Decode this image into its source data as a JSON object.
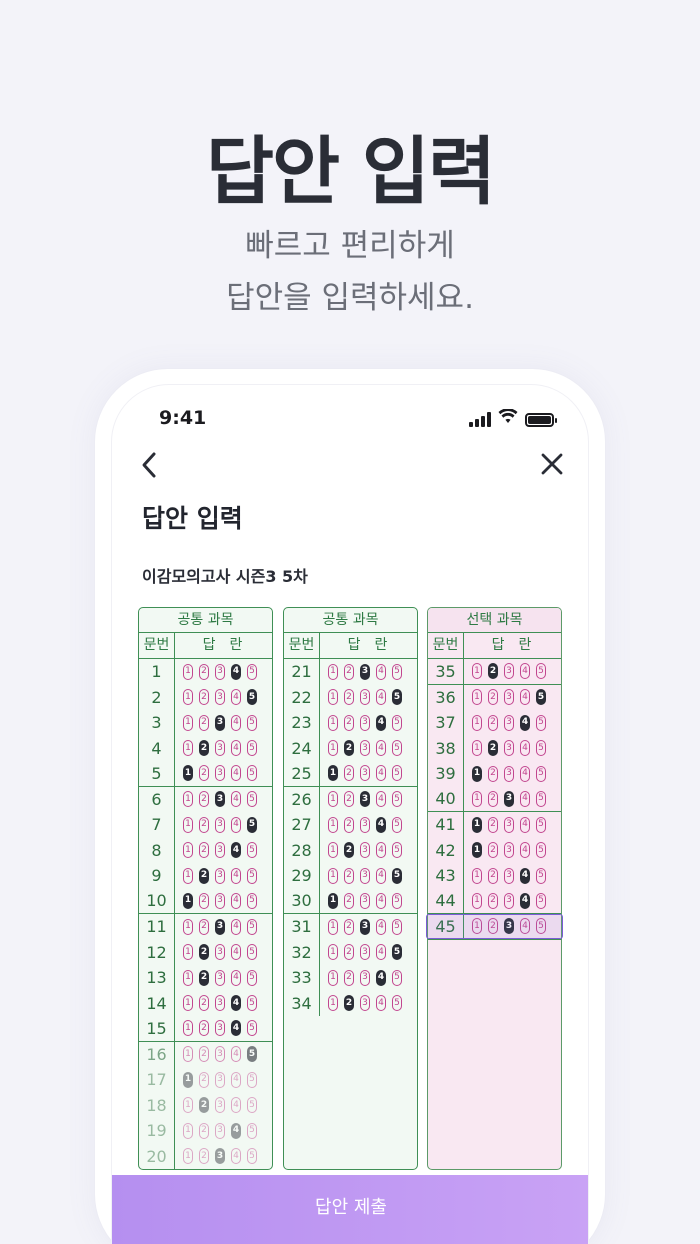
{
  "hero": {
    "title": "답안 입력",
    "sub1": "빠르고 편리하게",
    "sub2": "답안을 입력하세요."
  },
  "status": {
    "time": "9:41"
  },
  "header": {
    "back_icon": "chevron-left-icon",
    "close_icon": "close-icon",
    "title": "답안 입력",
    "exam_name": "이감모의고사 시즌3 5차"
  },
  "columns": [
    {
      "section": "공통 과목",
      "num_label": "문번",
      "ans_label": "답란",
      "theme": "green",
      "rows": [
        {
          "n": "1",
          "sel": 4
        },
        {
          "n": "2",
          "sel": 5
        },
        {
          "n": "3",
          "sel": 3
        },
        {
          "n": "4",
          "sel": 2
        },
        {
          "n": "5",
          "sel": 1
        },
        {
          "n": "6",
          "sel": 3
        },
        {
          "n": "7",
          "sel": 5
        },
        {
          "n": "8",
          "sel": 4
        },
        {
          "n": "9",
          "sel": 2
        },
        {
          "n": "10",
          "sel": 1
        },
        {
          "n": "11",
          "sel": 3
        },
        {
          "n": "12",
          "sel": 2
        },
        {
          "n": "13",
          "sel": 2
        },
        {
          "n": "14",
          "sel": 4
        },
        {
          "n": "15",
          "sel": 4
        },
        {
          "n": "16",
          "sel": 5
        },
        {
          "n": "17",
          "sel": 1
        },
        {
          "n": "18",
          "sel": 2
        },
        {
          "n": "19",
          "sel": 4
        },
        {
          "n": "20",
          "sel": 3
        }
      ]
    },
    {
      "section": "공통 과목",
      "num_label": "문번",
      "ans_label": "답란",
      "theme": "green",
      "rows": [
        {
          "n": "21",
          "sel": 3
        },
        {
          "n": "22",
          "sel": 5
        },
        {
          "n": "23",
          "sel": 4
        },
        {
          "n": "24",
          "sel": 2
        },
        {
          "n": "25",
          "sel": 1
        },
        {
          "n": "26",
          "sel": 3
        },
        {
          "n": "27",
          "sel": 4
        },
        {
          "n": "28",
          "sel": 2
        },
        {
          "n": "29",
          "sel": 5
        },
        {
          "n": "30",
          "sel": 1
        },
        {
          "n": "31",
          "sel": 3
        },
        {
          "n": "32",
          "sel": 5
        },
        {
          "n": "33",
          "sel": 4
        },
        {
          "n": "34",
          "sel": 2
        }
      ]
    },
    {
      "section": "선택 과목",
      "num_label": "문번",
      "ans_label": "답란",
      "theme": "pink",
      "rows": [
        {
          "n": "35",
          "sel": 2
        },
        {
          "n": "36",
          "sel": 5
        },
        {
          "n": "37",
          "sel": 4
        },
        {
          "n": "38",
          "sel": 2
        },
        {
          "n": "39",
          "sel": 1
        },
        {
          "n": "40",
          "sel": 3
        },
        {
          "n": "41",
          "sel": 1
        },
        {
          "n": "42",
          "sel": 1
        },
        {
          "n": "43",
          "sel": 4
        },
        {
          "n": "44",
          "sel": 4
        },
        {
          "n": "45",
          "sel": 3
        }
      ]
    }
  ],
  "submit": {
    "label": "답안 제출"
  },
  "colors": {
    "green": "#3f8f55",
    "pink_bubble": "#c2468f",
    "filled": "#2a2d36",
    "highlight": "#7b5cd6",
    "submit": "#b58ff0"
  }
}
